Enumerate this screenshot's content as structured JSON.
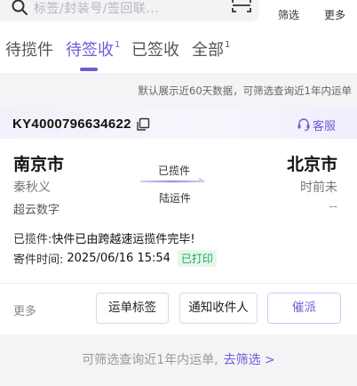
{
  "search": {
    "placeholder": "标签/封装号/签回联..."
  },
  "top_actions": {
    "filter_label": "筛选",
    "more_label": "更多"
  },
  "tabs": [
    {
      "label": "待揽件",
      "count": ""
    },
    {
      "label": "待签收",
      "count": "1"
    },
    {
      "label": "已签收",
      "count": ""
    },
    {
      "label": "全部",
      "count": "1"
    }
  ],
  "active_tab": "待签收",
  "notice": "默认展示近60天数据，可筛选查询近1年内运单",
  "order": {
    "waybill_no": "KY4000796634622",
    "service_label": "客服",
    "from": {
      "city": "南京市",
      "name": "秦秋义",
      "company": "超云数字"
    },
    "to": {
      "city": "北京市",
      "name": "时前未",
      "company": "--"
    },
    "status_top": "已揽件",
    "status_bottom": "陆运件",
    "pickup_label": "已揽件:",
    "pickup_text": "快件已由跨越速运揽件完毕!",
    "send_time_label": "寄件时间:",
    "send_time": "2025/06/16 15:54",
    "printed_badge": "已打印",
    "more_label": "更多",
    "buttons": {
      "label_btn": "运单标签",
      "notify_btn": "通知收件人",
      "urge_btn": "催派"
    }
  },
  "footer": {
    "tip": "可筛选查询近1年内运单,",
    "link": "去筛选 >"
  },
  "colors": {
    "accent": "#6f5cd6",
    "printed_green": "#1fa85a"
  }
}
